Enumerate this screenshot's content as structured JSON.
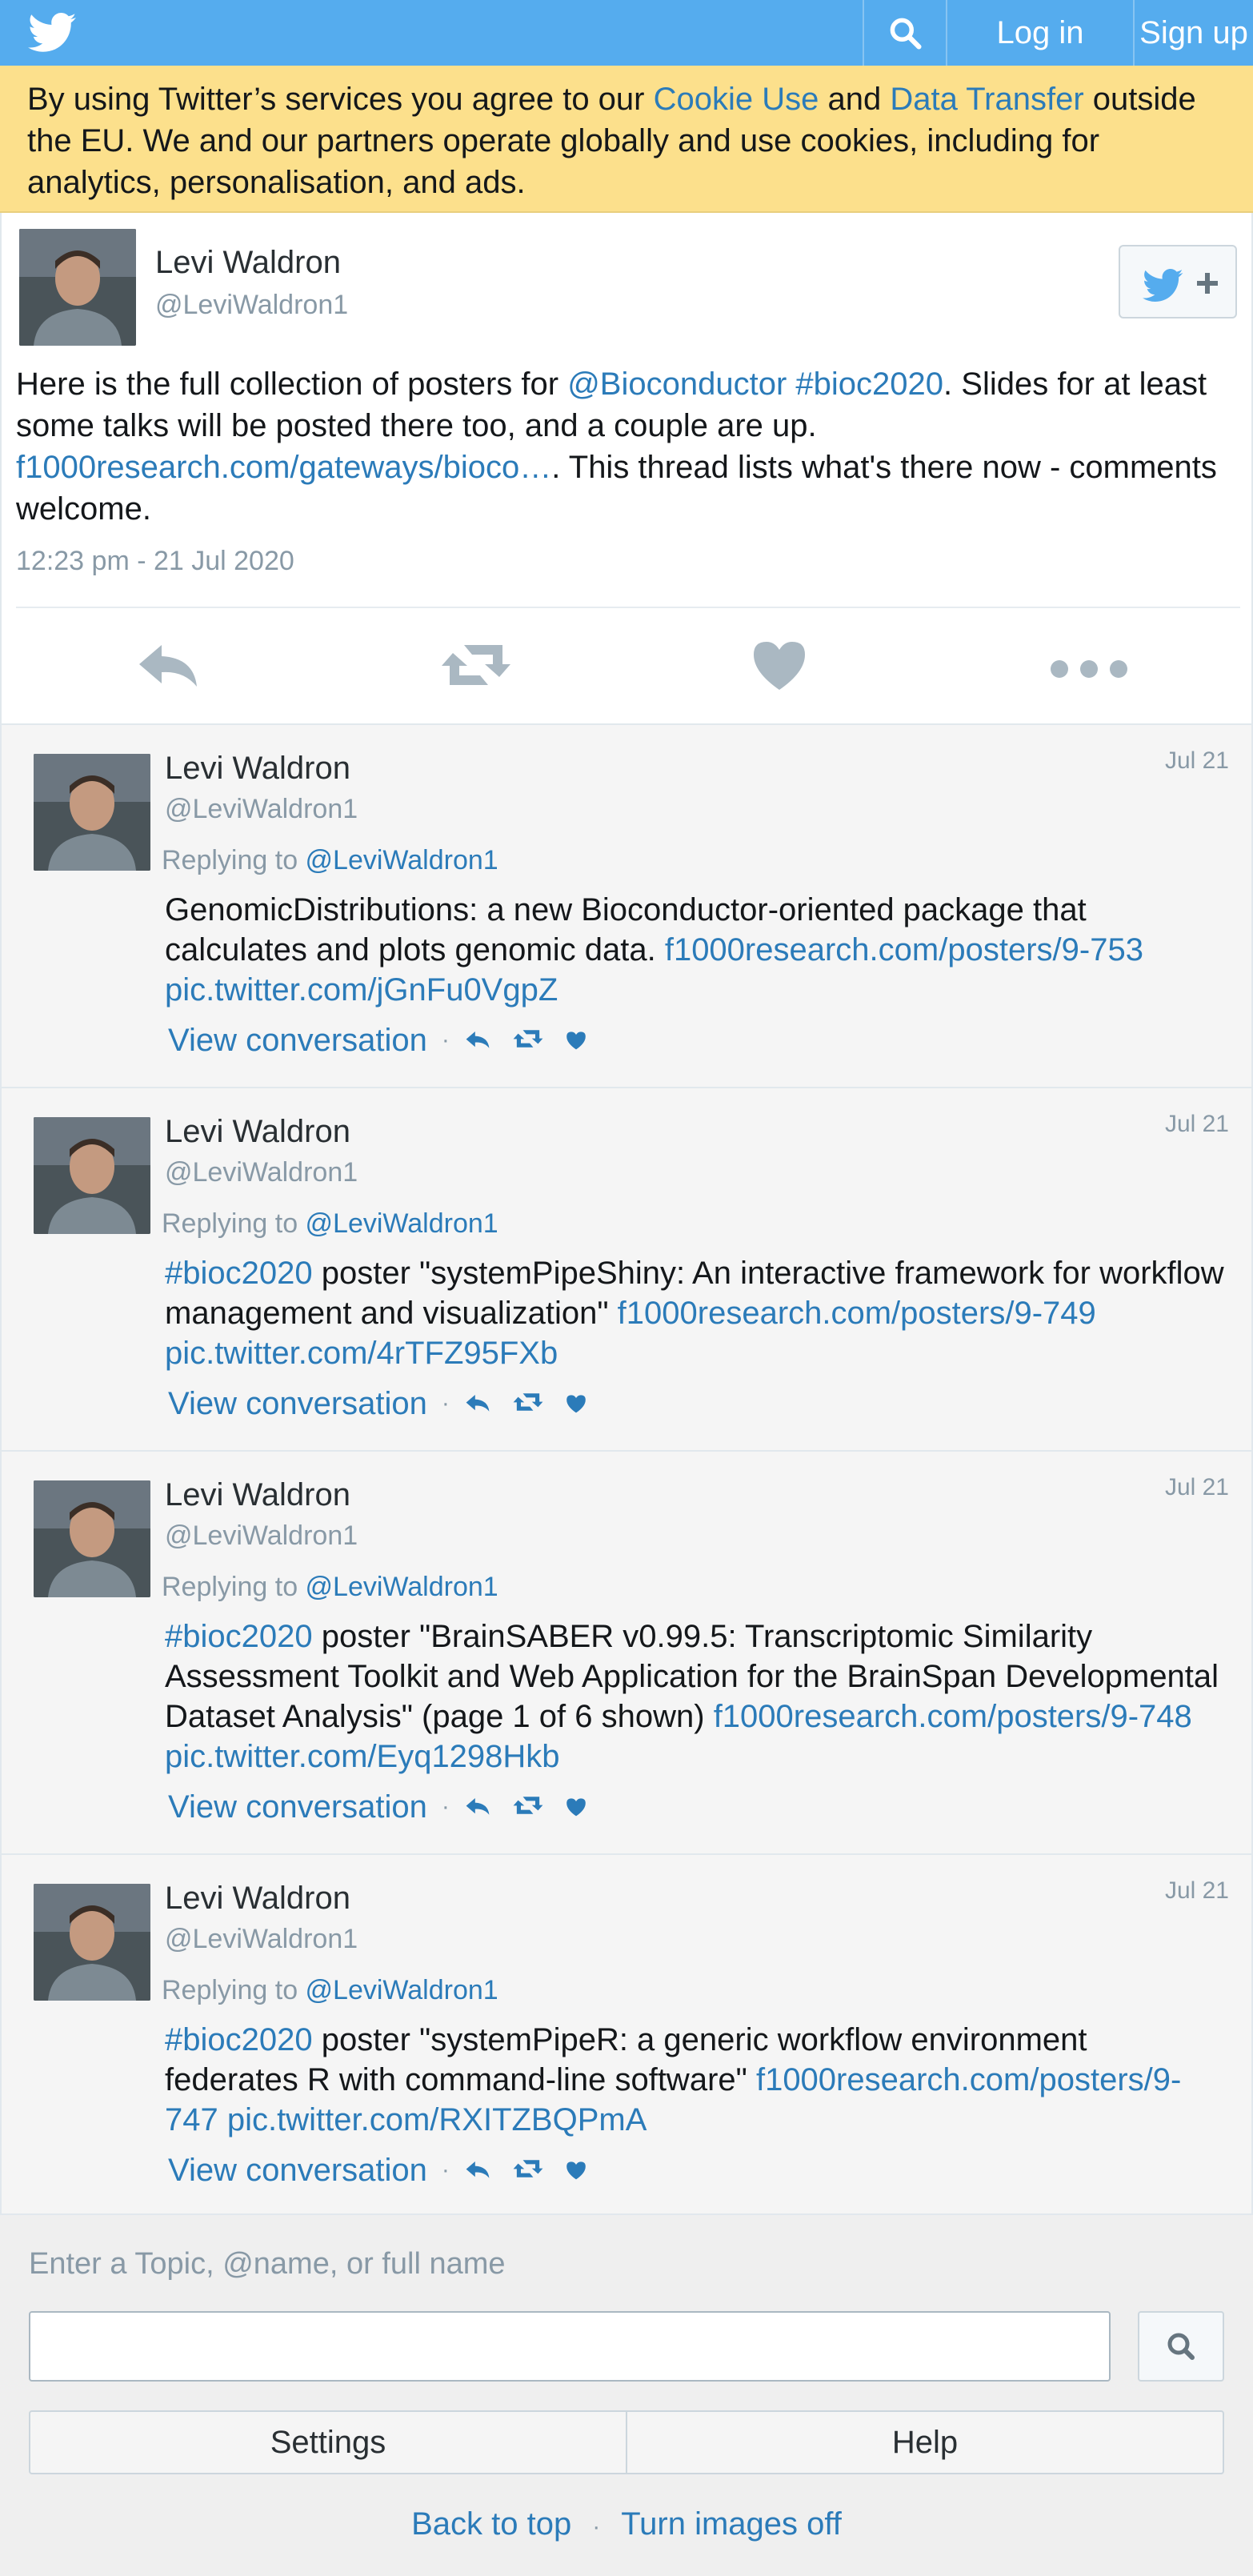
{
  "header": {
    "logo_icon": "twitter-bird-icon",
    "search_icon": "search-icon",
    "login_label": "Log in",
    "signup_label": "Sign up",
    "brand_color": "#55acee"
  },
  "cookie_banner": {
    "text_1": "By using Twitter’s services you agree to our ",
    "cookie_link": "Cookie Use",
    "text_2": " and ",
    "transfer_link": "Data Transfer",
    "text_3": " outside the EU. We and our partners operate globally and use cookies, including for analytics, personalisation, and ads."
  },
  "main_tweet": {
    "name": "Levi Waldron",
    "handle": "@LeviWaldron1",
    "follow_icon": "follow-bird-plus-icon",
    "text_1": "Here is the full collection of posters for ",
    "mention": "@Bioconductor",
    "hashtag": "#bioc2020",
    "text_2": ". Slides for at least some talks will be posted there too, and a couple are up. ",
    "link": "f1000research.com/gateways/bioco…",
    "text_3": ". This thread lists what's there now - comments welcome.",
    "timestamp": "12:23 pm - 21 Jul 2020",
    "actions": [
      "reply-icon",
      "retweet-icon",
      "like-icon",
      "more-icon"
    ]
  },
  "replies": [
    {
      "name": "Levi Waldron",
      "handle": "@LeviWaldron1",
      "date": "Jul 21",
      "replying_label": "Replying to ",
      "replying_to": "@LeviWaldron1",
      "hashtag": "",
      "text": "GenomicDistributions: a new Bioconductor-oriented package that calculates and plots genomic data. ",
      "link": "f1000research.com/posters/9-753",
      "pic": "pic.twitter.com/jGnFu0VgpZ",
      "view_label": "View conversation"
    },
    {
      "name": "Levi Waldron",
      "handle": "@LeviWaldron1",
      "date": "Jul 21",
      "replying_label": "Replying to ",
      "replying_to": "@LeviWaldron1",
      "hashtag": "#bioc2020",
      "text": " poster \"systemPipeShiny: An interactive framework for workflow management and visualization\" ",
      "link": "f1000research.com/posters/9-749",
      "pic": "pic.twitter.com/4rTFZ95FXb",
      "view_label": "View conversation"
    },
    {
      "name": "Levi Waldron",
      "handle": "@LeviWaldron1",
      "date": "Jul 21",
      "replying_label": "Replying to ",
      "replying_to": "@LeviWaldron1",
      "hashtag": "#bioc2020",
      "text": " poster \"BrainSABER v0.99.5: Transcriptomic Similarity Assessment Toolkit and Web Application for the BrainSpan Developmental Dataset Analysis\" (page 1 of 6 shown) ",
      "link": "f1000research.com/posters/9-748",
      "pic": "pic.twitter.com/Eyq1298Hkb",
      "view_label": "View conversation"
    },
    {
      "name": "Levi Waldron",
      "handle": "@LeviWaldron1",
      "date": "Jul 21",
      "replying_label": "Replying to ",
      "replying_to": "@LeviWaldron1",
      "hashtag": "#bioc2020",
      "text": " poster \"systemPipeR: a generic workflow environment federates R with command-line software\" ",
      "link": "f1000research.com/posters/9-747",
      "pic": "pic.twitter.com/RXITZBQPmA",
      "view_label": "View conversation"
    }
  ],
  "bottom": {
    "search_label": "Enter a Topic, @name, or full name",
    "search_value": "",
    "settings_label": "Settings",
    "help_label": "Help",
    "back_to_top": "Back to top",
    "images_off": "Turn images off",
    "separator": "·"
  }
}
